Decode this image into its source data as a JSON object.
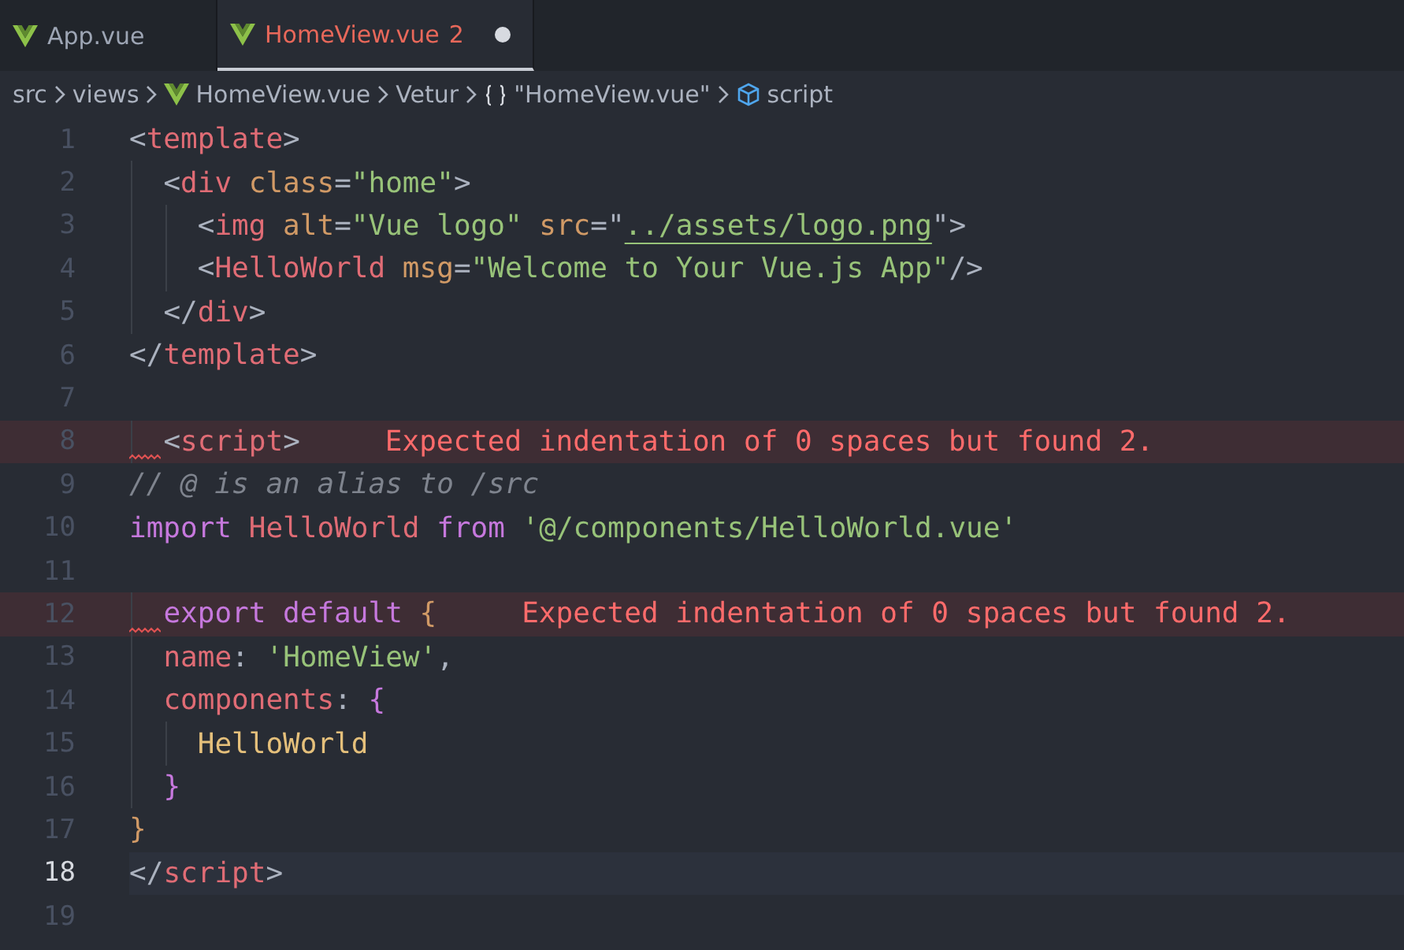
{
  "tabs": [
    {
      "label": "App.vue",
      "selected": false,
      "has_errors": false,
      "modified": false
    },
    {
      "label": "HomeView.vue",
      "selected": true,
      "has_errors": true,
      "problems": "2",
      "modified": true
    }
  ],
  "breadcrumbs": [
    {
      "label": "src",
      "kind": "folder"
    },
    {
      "label": "views",
      "kind": "folder"
    },
    {
      "label": "HomeView.vue",
      "kind": "vue-file"
    },
    {
      "label": "Vetur",
      "kind": "folder"
    },
    {
      "label": "\"HomeView.vue\"",
      "kind": "object"
    },
    {
      "label": "script",
      "kind": "module"
    }
  ],
  "editor": {
    "lines": [
      {
        "number": "1",
        "current": false,
        "tokens": [
          {
            "kind": "punct",
            "text": "<"
          },
          {
            "kind": "tag",
            "text": "template"
          },
          {
            "kind": "punct",
            "text": ">"
          }
        ]
      },
      {
        "number": "2",
        "current": false,
        "tokens": [
          {
            "kind": "punct",
            "text": "  <"
          },
          {
            "kind": "tag",
            "text": "div"
          },
          {
            "kind": "attr",
            "text": " class"
          },
          {
            "kind": "punct",
            "text": "="
          },
          {
            "kind": "string",
            "text": "\"home\""
          },
          {
            "kind": "punct",
            "text": ">"
          }
        ]
      },
      {
        "number": "3",
        "current": false,
        "tokens": [
          {
            "kind": "punct",
            "text": "    <"
          },
          {
            "kind": "tag",
            "text": "img"
          },
          {
            "kind": "attr",
            "text": " alt"
          },
          {
            "kind": "punct",
            "text": "="
          },
          {
            "kind": "string",
            "text": "\"Vue logo\""
          },
          {
            "kind": "attr",
            "text": " src"
          },
          {
            "kind": "punct",
            "text": "=\""
          },
          {
            "kind": "link",
            "text": "../assets/logo.png"
          },
          {
            "kind": "punct",
            "text": "\">"
          }
        ]
      },
      {
        "number": "4",
        "current": false,
        "tokens": [
          {
            "kind": "punct",
            "text": "    <"
          },
          {
            "kind": "tag",
            "text": "HelloWorld"
          },
          {
            "kind": "attr",
            "text": " msg"
          },
          {
            "kind": "punct",
            "text": "="
          },
          {
            "kind": "string",
            "text": "\"Welcome to Your Vue.js App\""
          },
          {
            "kind": "punct",
            "text": "/>"
          }
        ]
      },
      {
        "number": "5",
        "current": false,
        "tokens": [
          {
            "kind": "punct",
            "text": "  </"
          },
          {
            "kind": "tag",
            "text": "div"
          },
          {
            "kind": "punct",
            "text": ">"
          }
        ]
      },
      {
        "number": "6",
        "current": false,
        "tokens": [
          {
            "kind": "punct",
            "text": "</"
          },
          {
            "kind": "tag",
            "text": "template"
          },
          {
            "kind": "punct",
            "text": ">"
          }
        ]
      },
      {
        "number": "7",
        "current": false
      },
      {
        "number": "8",
        "current": false,
        "error": {
          "message": "Expected indentation of 0 spaces but found 2."
        },
        "tokens": [
          {
            "kind": "punct",
            "text": "  <"
          },
          {
            "kind": "tag",
            "text": "script"
          },
          {
            "kind": "punct",
            "text": ">"
          }
        ]
      },
      {
        "number": "9",
        "current": false,
        "tokens": [
          {
            "kind": "comment",
            "text": "// @ is an alias to /src"
          }
        ]
      },
      {
        "number": "10",
        "current": false,
        "tokens": [
          {
            "kind": "keyword",
            "text": "import"
          },
          {
            "kind": "tag",
            "text": " HelloWorld"
          },
          {
            "kind": "keyword",
            "text": " from"
          },
          {
            "kind": "string",
            "text": " '@/components/HelloWorld.vue'"
          }
        ]
      },
      {
        "number": "11",
        "current": false
      },
      {
        "number": "12",
        "current": false,
        "error": {
          "message": "Expected indentation of 0 spaces but found 2."
        },
        "tokens": [
          {
            "kind": "keyword",
            "text": "  export default"
          },
          {
            "kind": "brace",
            "text": " {"
          }
        ]
      },
      {
        "number": "13",
        "current": false,
        "tokens": [
          {
            "kind": "tag",
            "text": "  name"
          },
          {
            "kind": "punct",
            "text": ": "
          },
          {
            "kind": "string",
            "text": "'HomeView'"
          },
          {
            "kind": "punct",
            "text": ","
          }
        ]
      },
      {
        "number": "14",
        "current": false,
        "tokens": [
          {
            "kind": "tag",
            "text": "  components"
          },
          {
            "kind": "punct",
            "text": ": "
          },
          {
            "kind": "brace2",
            "text": "{"
          }
        ]
      },
      {
        "number": "15",
        "current": false,
        "tokens": [
          {
            "kind": "class",
            "text": "    HelloWorld"
          }
        ]
      },
      {
        "number": "16",
        "current": false,
        "tokens": [
          {
            "kind": "brace2",
            "text": "  }"
          }
        ]
      },
      {
        "number": "17",
        "current": false,
        "tokens": [
          {
            "kind": "brace",
            "text": "}"
          }
        ]
      },
      {
        "number": "18",
        "current": true,
        "tokens": [
          {
            "kind": "punct",
            "text": "</"
          },
          {
            "kind": "tag",
            "text": "script"
          },
          {
            "kind": "punct",
            "text": ">"
          }
        ]
      },
      {
        "number": "19",
        "current": false
      }
    ]
  }
}
